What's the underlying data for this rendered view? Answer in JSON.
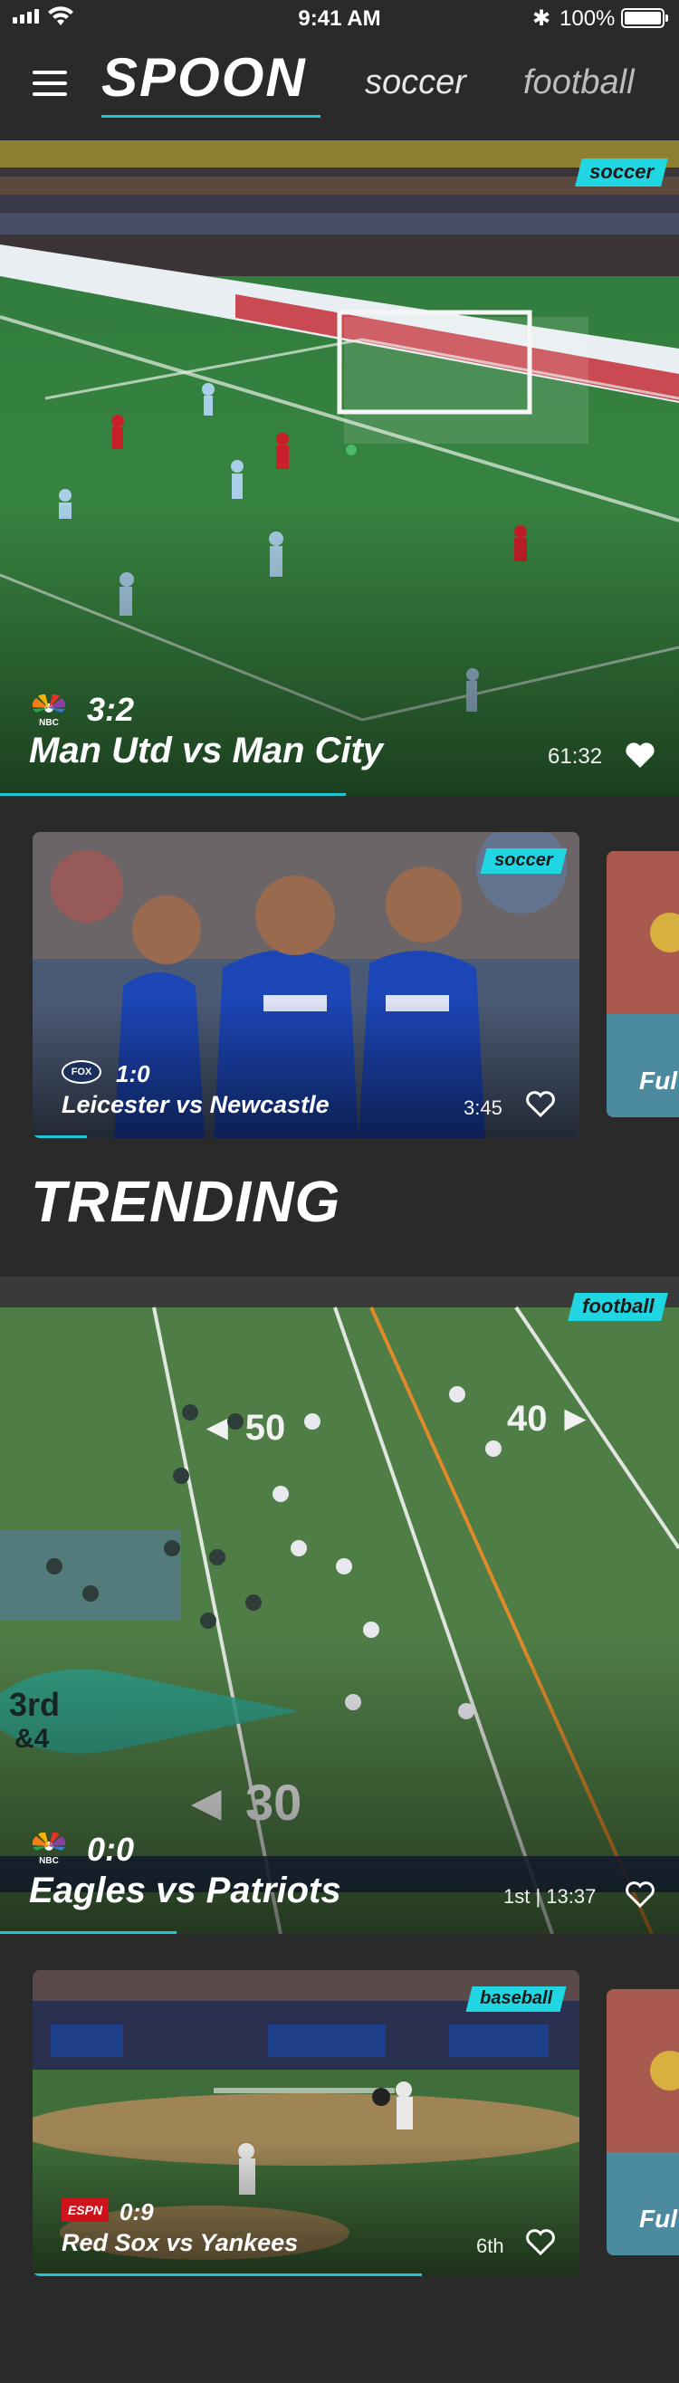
{
  "status_bar": {
    "time": "9:41 AM",
    "battery": "100%",
    "bluetooth_icon": "bluetooth-icon"
  },
  "nav": {
    "logo": "SPOON",
    "tabs": [
      {
        "label": "soccer"
      },
      {
        "label": "football"
      }
    ]
  },
  "hero": {
    "tag": "soccer",
    "network": "NBC",
    "score": "3:2",
    "title": "Man Utd vs Man City",
    "time": "61:32",
    "progress": 0.51
  },
  "carousel_1": {
    "card": {
      "tag": "soccer",
      "network": "FOX",
      "score": "1:0",
      "title": "Leicester vs Newcastle",
      "time": "3:45",
      "progress": 0.1
    },
    "peek_text": "Ful"
  },
  "trending": {
    "title": "TRENDING",
    "feature": {
      "tag": "football",
      "network": "NBC",
      "score": "0:0",
      "title": "Eagles vs Patriots",
      "time": "1st | 13:37",
      "progress": 0.26
    }
  },
  "carousel_2": {
    "card": {
      "tag": "baseball",
      "network": "ESPN",
      "score": "0:9",
      "title": "Red Sox vs Yankees",
      "time": "6th",
      "progress": 0.71
    },
    "peek_text": "Ful"
  },
  "colors": {
    "accent": "#21c6d3",
    "tag_bg": "#21d6e3",
    "background": "#2a2a2a"
  }
}
